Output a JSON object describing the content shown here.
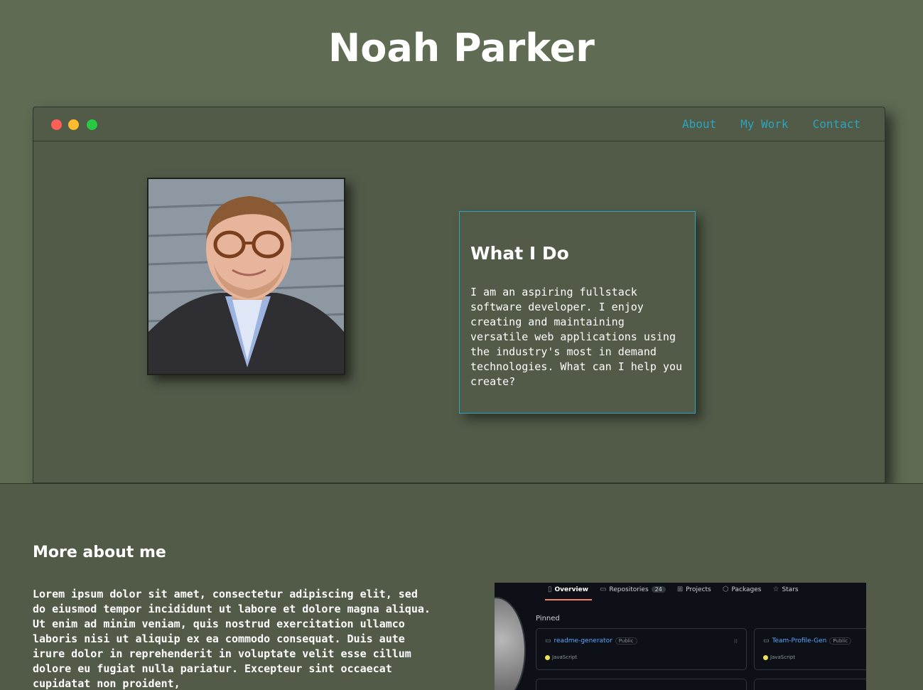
{
  "header": {
    "title": "Noah Parker"
  },
  "window": {
    "nav": [
      {
        "label": "About"
      },
      {
        "label": "My Work"
      },
      {
        "label": "Contact"
      }
    ]
  },
  "what_i_do": {
    "heading": "What I Do",
    "body": "I am an aspiring fullstack software developer. I enjoy creating and maintaining versatile web applications using the industry's most in demand technologies. What can I help you create?"
  },
  "about": {
    "heading": "More about me",
    "body": "Lorem ipsum dolor sit amet, consectetur adipiscing elit, sed do eiusmod tempor incididunt ut labore et dolore magna aliqua. Ut enim ad minim veniam, quis nostrud exercitation ullamco laboris nisi ut aliquip ex ea commodo consequat. Duis aute irure dolor in reprehenderit in voluptate velit esse cillum dolore eu fugiat nulla pariatur. Excepteur sint occaecat cupidatat non proident,"
  },
  "github": {
    "tabs": [
      {
        "label": "Overview",
        "icon": "book-open-icon"
      },
      {
        "label": "Repositories",
        "icon": "repo-icon",
        "count": "24"
      },
      {
        "label": "Projects",
        "icon": "table-icon"
      },
      {
        "label": "Packages",
        "icon": "package-icon"
      },
      {
        "label": "Stars",
        "icon": "star-icon"
      }
    ],
    "pinned_label": "Pinned",
    "repos": [
      {
        "name": "readme-generator",
        "visibility": "Public",
        "language": "JavaScript"
      },
      {
        "name": "Team-Profile-Gen",
        "visibility": "Public",
        "language": "JavaScript"
      }
    ]
  },
  "colors": {
    "background": "#5f6b53",
    "panel": "#515b48",
    "accent": "#2aa6c0",
    "text": "#ffffff"
  }
}
